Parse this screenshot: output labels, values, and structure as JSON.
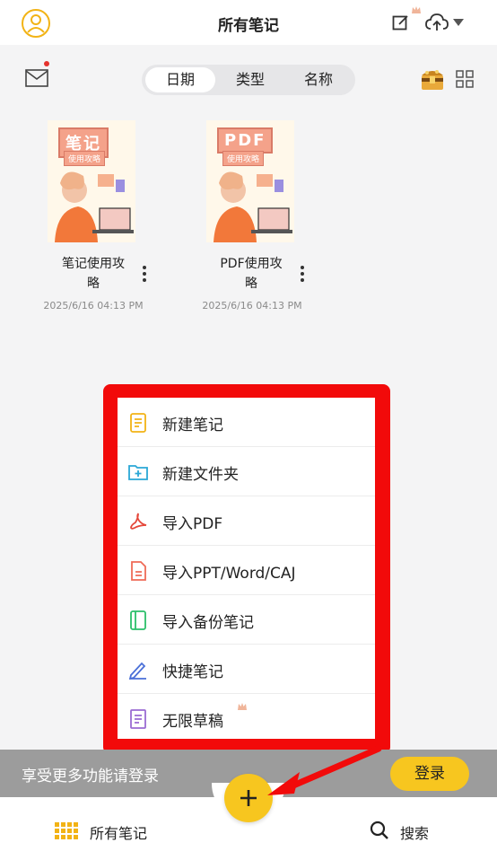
{
  "header": {
    "title": "所有笔记"
  },
  "toolbar": {
    "sort_tabs": [
      {
        "label": "日期",
        "active": true
      },
      {
        "label": "类型",
        "active": false
      },
      {
        "label": "名称",
        "active": false
      }
    ],
    "mail_unread": true
  },
  "notes": [
    {
      "thumb_title": "笔记",
      "thumb_subtitle": "使用攻略",
      "name_line1": "笔记使用攻",
      "name_line2": "略",
      "date": "2025/6/16 04:13 PM"
    },
    {
      "thumb_title": "PDF",
      "thumb_subtitle": "使用攻略",
      "name_line1": "PDF使用攻",
      "name_line2": "略",
      "date": "2025/6/16 04:13 PM"
    }
  ],
  "menu": {
    "items": [
      {
        "label": "新建笔记",
        "icon": "new-note-icon",
        "color": "#f2b315"
      },
      {
        "label": "新建文件夹",
        "icon": "new-folder-icon",
        "color": "#2aa7d6"
      },
      {
        "label": "导入PDF",
        "icon": "pdf-icon",
        "color": "#e5473a"
      },
      {
        "label": "导入PPT/Word/CAJ",
        "icon": "document-icon",
        "color": "#ef6b57"
      },
      {
        "label": "导入备份笔记",
        "icon": "backup-icon",
        "color": "#2bbf6a"
      },
      {
        "label": "快捷笔记",
        "icon": "pen-icon",
        "color": "#4a6fd8"
      },
      {
        "label": "无限草稿",
        "icon": "draft-icon",
        "color": "#9b6bd3"
      }
    ]
  },
  "login_bar": {
    "text": "享受更多功能请登录",
    "button": "登录"
  },
  "bottom_nav": {
    "all_notes": "所有笔记",
    "search": "搜索"
  },
  "colors": {
    "accent": "#f7c61f",
    "highlight": "#f20a0a",
    "login_bar": "#9c9c9c"
  }
}
